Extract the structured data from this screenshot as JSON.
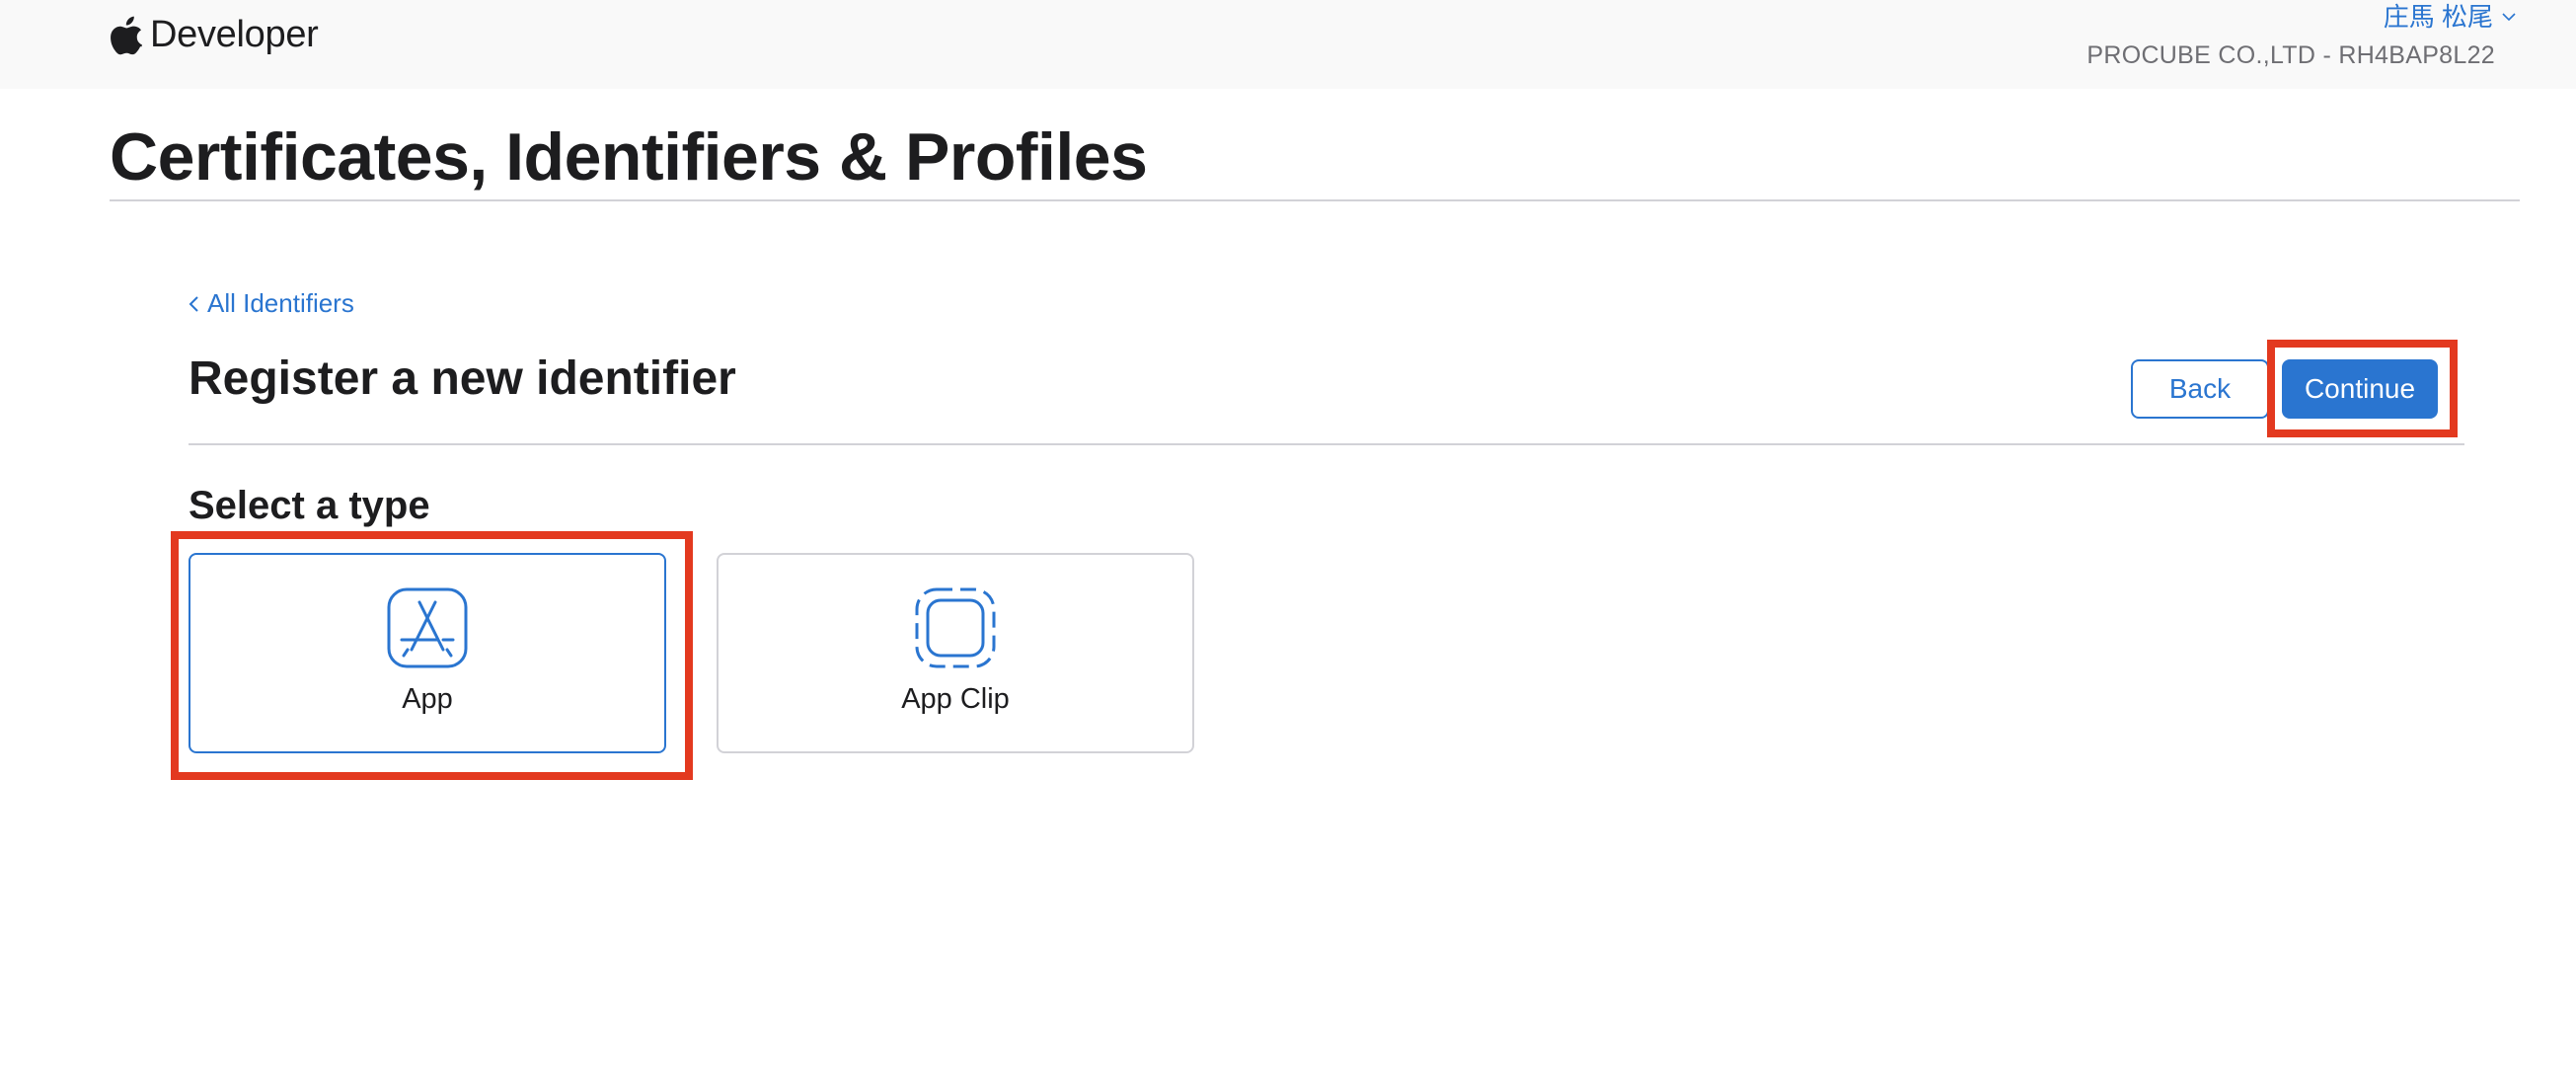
{
  "header": {
    "brand": "Developer",
    "user_name": "庄馬 松尾",
    "team": "PROCUBE CO.,LTD - RH4BAP8L22"
  },
  "page": {
    "title": "Certificates, Identifiers & Profiles"
  },
  "content": {
    "back_link": "All Identifiers",
    "section_title": "Register a new identifier",
    "back_button": "Back",
    "continue_button": "Continue",
    "select_type_title": "Select a type",
    "types": [
      {
        "label": "App",
        "icon": "app-store-icon",
        "selected": true
      },
      {
        "label": "App Clip",
        "icon": "app-clip-icon",
        "selected": false
      }
    ]
  },
  "colors": {
    "accent": "#2a75d0",
    "highlight": "#e3391f",
    "header_bg": "#f9f9f9"
  }
}
